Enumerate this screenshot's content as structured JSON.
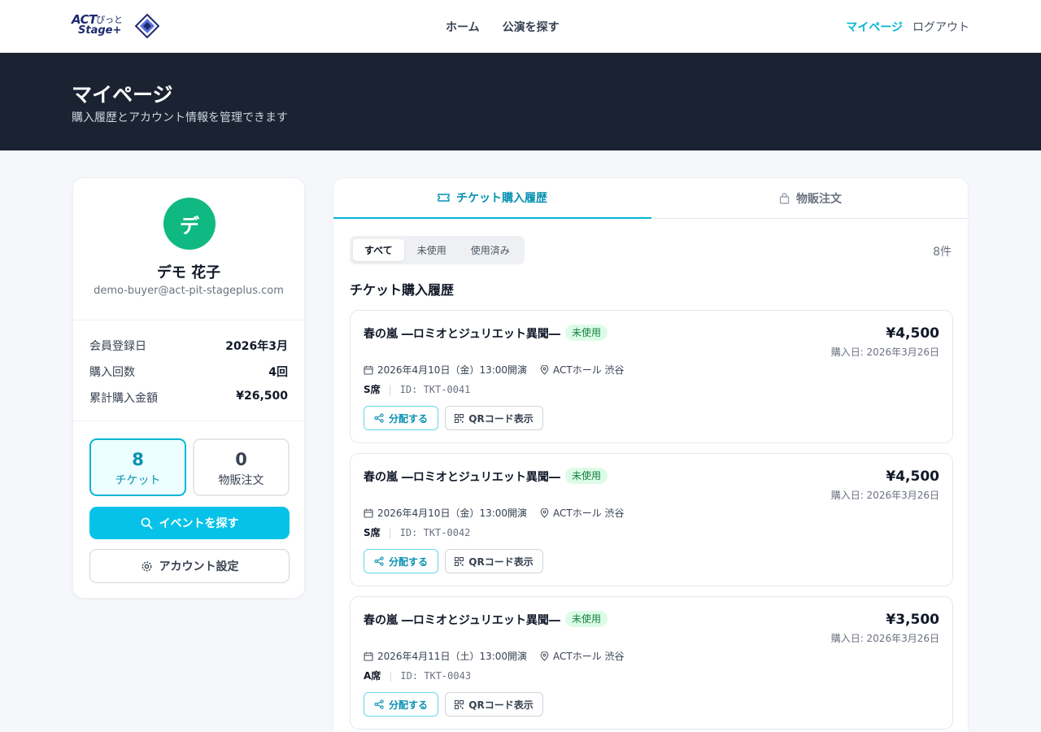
{
  "header": {
    "logo_text_1": "ACT",
    "logo_text_2": "ぴっと",
    "logo_text_3": "Stage+",
    "nav": [
      "ホーム",
      "公演を探す"
    ],
    "mypage": "マイページ",
    "logout": "ログアウト"
  },
  "hero": {
    "title": "マイページ",
    "subtitle": "購入履歴とアカウント情報を管理できます"
  },
  "profile": {
    "avatar_char": "デ",
    "name": "デモ 花子",
    "email": "demo-buyer@act-pit-stageplus.com",
    "stats": [
      {
        "label": "会員登録日",
        "value": "2026年3月"
      },
      {
        "label": "購入回数",
        "value": "4回"
      },
      {
        "label": "累計購入金額",
        "value": "¥26,500"
      }
    ],
    "tickets_count": "8",
    "tickets_label": "チケット",
    "merch_count": "0",
    "merch_label": "物販注文",
    "find_button": "イベントを探す",
    "settings_button": "アカウント設定"
  },
  "main": {
    "tabs": [
      "チケット購入履歴",
      "物販注文"
    ],
    "filters": [
      "すべて",
      "未使用",
      "使用済み"
    ],
    "count": "8件",
    "section_title": "チケット購入履歴",
    "tickets": [
      {
        "title": "春の嵐 ―ロミオとジュリエット異聞―",
        "badge": "未使用",
        "price": "¥4,500",
        "purchase_date": "購入日: 2026年3月26日",
        "datetime": "2026年4月10日（金）13:00開演",
        "venue": "ACTホール 渋谷",
        "seat": "S席",
        "id": "ID: TKT-0041",
        "share": "分配する",
        "qr": "QRコード表示"
      },
      {
        "title": "春の嵐 ―ロミオとジュリエット異聞―",
        "badge": "未使用",
        "price": "¥4,500",
        "purchase_date": "購入日: 2026年3月26日",
        "datetime": "2026年4月10日（金）13:00開演",
        "venue": "ACTホール 渋谷",
        "seat": "S席",
        "id": "ID: TKT-0042",
        "share": "分配する",
        "qr": "QRコード表示"
      },
      {
        "title": "春の嵐 ―ロミオとジュリエット異聞―",
        "badge": "未使用",
        "price": "¥3,500",
        "purchase_date": "購入日: 2026年3月26日",
        "datetime": "2026年4月11日（土）13:00開演",
        "venue": "ACTホール 渋谷",
        "seat": "A席",
        "id": "ID: TKT-0043",
        "share": "分配する",
        "qr": "QRコード表示"
      }
    ]
  },
  "colors": {
    "accent": "#06b6d4",
    "hero_bg": "#1b2332",
    "avatar": "#10b981",
    "badge_bg": "#dcfce7",
    "badge_text": "#15803d"
  }
}
